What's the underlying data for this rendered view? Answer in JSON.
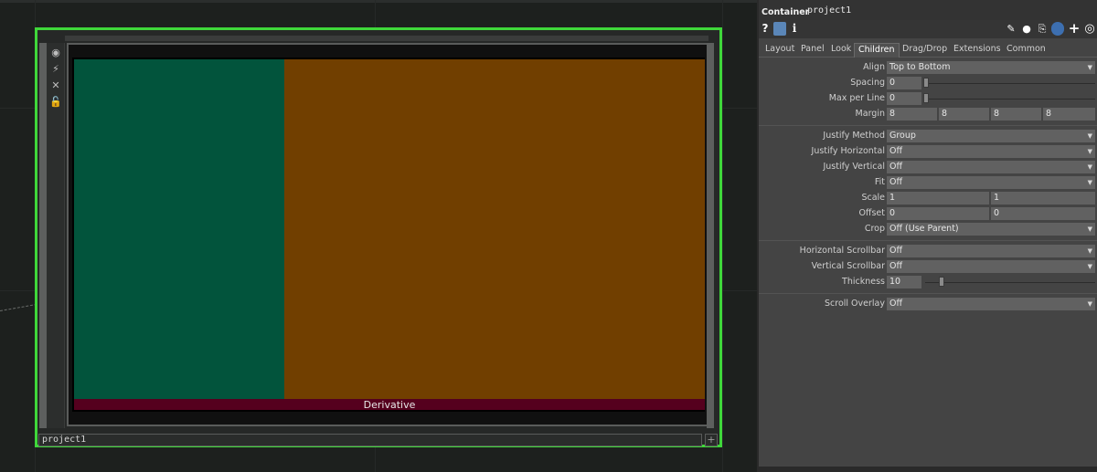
{
  "network": {
    "node": {
      "name": "project1",
      "toolbar_icons": [
        "viewer-toggle-icon",
        "cook-icon",
        "bypass-icon",
        "lock-icon"
      ],
      "panels": {
        "left_color": "#02543c",
        "right_color": "#713f00",
        "bottom_color": "#55001e",
        "bottom_label": "Derivative"
      },
      "add_label": "+"
    },
    "selection_color": "#3fd73a"
  },
  "params": {
    "op_type": "Container",
    "op_name": "project1",
    "icons": [
      "help-icon",
      "python-help-icon",
      "info-icon",
      "edit-icon",
      "comment-icon",
      "clone-icon",
      "python-icon",
      "add-icon",
      "target-icon"
    ],
    "icon_glyphs": {
      "help": "?",
      "info": "i",
      "add": "+"
    },
    "tabs": [
      "Layout",
      "Panel",
      "Look",
      "Children",
      "Drag/Drop",
      "Extensions",
      "Common"
    ],
    "active_tab": "Children",
    "rows": {
      "align": {
        "label": "Align",
        "value": "Top to Bottom"
      },
      "spacing": {
        "label": "Spacing",
        "value": "0"
      },
      "max_per_line": {
        "label": "Max per Line",
        "value": "0"
      },
      "margin": {
        "label": "Margin",
        "values": [
          "8",
          "8",
          "8",
          "8"
        ]
      },
      "justify_method": {
        "label": "Justify Method",
        "value": "Group"
      },
      "justify_horizontal": {
        "label": "Justify Horizontal",
        "value": "Off"
      },
      "justify_vertical": {
        "label": "Justify Vertical",
        "value": "Off"
      },
      "fit": {
        "label": "Fit",
        "value": "Off"
      },
      "scale": {
        "label": "Scale",
        "values": [
          "1",
          "1"
        ]
      },
      "offset": {
        "label": "Offset",
        "values": [
          "0",
          "0"
        ]
      },
      "crop": {
        "label": "Crop",
        "value": "Off (Use Parent)"
      },
      "horizontal_scrollbar": {
        "label": "Horizontal Scrollbar",
        "value": "Off"
      },
      "vertical_scrollbar": {
        "label": "Vertical Scrollbar",
        "value": "Off"
      },
      "thickness": {
        "label": "Thickness",
        "value": "10"
      },
      "scroll_overlay": {
        "label": "Scroll Overlay",
        "value": "Off"
      }
    },
    "dropdown_arrow": "▼"
  }
}
